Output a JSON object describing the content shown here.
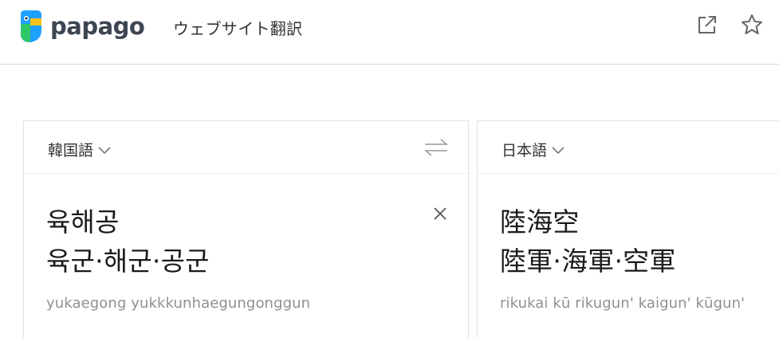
{
  "header": {
    "logo_text": "papago",
    "service_title": "ウェブサイト翻訳",
    "buttons": [
      {
        "icon": "open-external-icon"
      },
      {
        "icon": "star-icon"
      }
    ]
  },
  "source": {
    "language": "韓国語",
    "lines": [
      "육해공",
      "육군·해군·공군"
    ],
    "pronunciation": "yukaegong yukkkunhaegungonggun"
  },
  "target": {
    "language": "日本語",
    "lines": [
      "陸海空",
      "陸軍·海軍·空軍"
    ],
    "pronunciation": "rikukai kū rikugun' kaigun' kūgun'"
  },
  "colors": {
    "logo_blue": "#1ea0ff",
    "logo_green": "#2fc768",
    "logo_yellow": "#ffc21a",
    "logo_text": "#3d4552",
    "border": "#e1e1e1",
    "pronunciation": "#909090"
  }
}
